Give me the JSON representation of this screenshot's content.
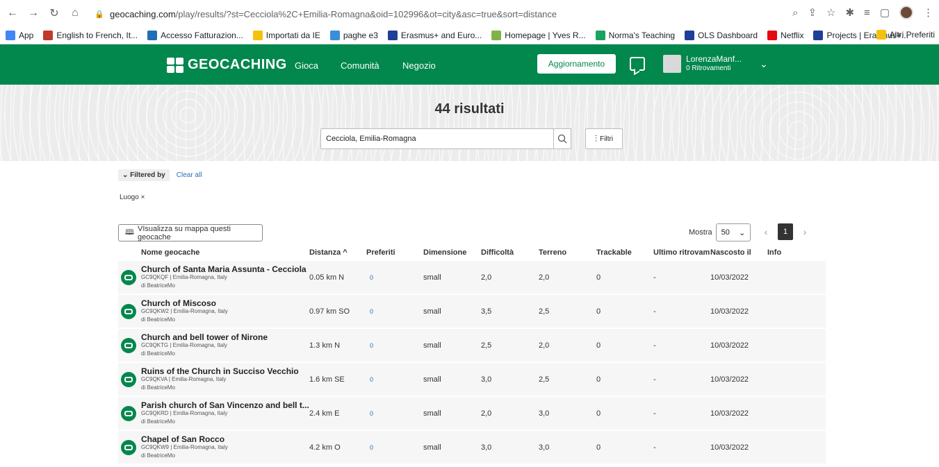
{
  "browser": {
    "url_domain": "geocaching.com",
    "url_path": "/play/results/?st=Cecciola%2C+Emilia-Romagna&oid=102996&ot=city&asc=true&sort=distance",
    "bookmarks": [
      {
        "label": "App",
        "color": "#4285f4"
      },
      {
        "label": "English to French, It...",
        "color": "#c0392b"
      },
      {
        "label": "Accesso Fatturazion...",
        "color": "#1e6fb8"
      },
      {
        "label": "Importati da IE",
        "color": "#f4c20d"
      },
      {
        "label": "paghe e3",
        "color": "#3b8ed8"
      },
      {
        "label": "Erasmus+ and Euro...",
        "color": "#1f3f99"
      },
      {
        "label": "Homepage | Yves R...",
        "color": "#7fb34a"
      },
      {
        "label": "Norma's Teaching",
        "color": "#1aa260"
      },
      {
        "label": "OLS Dashboard",
        "color": "#1f3f99"
      },
      {
        "label": "Netflix",
        "color": "#e50914"
      },
      {
        "label": "Projects | Erasmus+...",
        "color": "#1f3f99"
      }
    ],
    "other_bookmarks": "Altri Preferiti"
  },
  "header": {
    "logo": "GEOCACHING",
    "nav": [
      "Gioca",
      "Comunità",
      "Negozio"
    ],
    "upgrade": "Aggiornamento",
    "user_name": "LorenzaManf...",
    "user_finds": "0 Ritrovamenti"
  },
  "hero": {
    "title": "44 risultati",
    "search_value": "Cecciola, Emilia-Romagna",
    "filter_label": "Filtri"
  },
  "filters": {
    "filtered_by": "Filtered by",
    "clear_all": "Clear all",
    "chip": "Luogo ×"
  },
  "toolbar": {
    "map_button": "VIsualizza su mappa questi geocache",
    "show_label": "Mostra",
    "show_value": "50",
    "page": "1"
  },
  "table": {
    "headers": [
      "Nome geocache",
      "Distanza ^",
      "Preferiti",
      "Dimensione",
      "Difficoltà",
      "Terreno",
      "Trackable",
      "Ultimo ritrovam",
      "Nascosto il",
      "Info"
    ],
    "rows": [
      {
        "name": "Church of Santa Maria Assunta - Cecciola",
        "meta": "GC9QKQF | Emilia-Romagna, Italy",
        "by": "di BeatriceMo",
        "distance": "0.05 km N",
        "favorites": "0",
        "size": "small",
        "difficulty": "2,0",
        "terrain": "2,0",
        "trackable": "0",
        "last_found": "-",
        "hidden": "10/03/2022"
      },
      {
        "name": "Church of Miscoso",
        "meta": "GC9QKW2 | Emilia-Romagna, Italy",
        "by": "di BeatriceMo",
        "distance": "0.97 km SO",
        "favorites": "0",
        "size": "small",
        "difficulty": "3,5",
        "terrain": "2,5",
        "trackable": "0",
        "last_found": "-",
        "hidden": "10/03/2022"
      },
      {
        "name": "Church and bell tower of Nirone",
        "meta": "GC9QKTG | Emilia-Romagna, Italy",
        "by": "di BeatriceMo",
        "distance": "1.3 km N",
        "favorites": "0",
        "size": "small",
        "difficulty": "2,5",
        "terrain": "2,0",
        "trackable": "0",
        "last_found": "-",
        "hidden": "10/03/2022"
      },
      {
        "name": "Ruins of the Church in Succiso Vecchio",
        "meta": "GC9QKVA | Emilia-Romagna, Italy",
        "by": "di BeatriceMo",
        "distance": "1.6 km SE",
        "favorites": "0",
        "size": "small",
        "difficulty": "3,0",
        "terrain": "2,5",
        "trackable": "0",
        "last_found": "-",
        "hidden": "10/03/2022"
      },
      {
        "name": "Parish church of San Vincenzo and bell t...",
        "meta": "GC9QKRD | Emilia-Romagna, Italy",
        "by": "di BeatriceMo",
        "distance": "2.4 km E",
        "favorites": "0",
        "size": "small",
        "difficulty": "2,0",
        "terrain": "3,0",
        "trackable": "0",
        "last_found": "-",
        "hidden": "10/03/2022"
      },
      {
        "name": "Chapel of San Rocco",
        "meta": "GC9QKW9 | Emilia-Romagna, Italy",
        "by": "di BeatriceMo",
        "distance": "4.2 km O",
        "favorites": "0",
        "size": "small",
        "difficulty": "3,0",
        "terrain": "3,0",
        "trackable": "0",
        "last_found": "-",
        "hidden": "10/03/2022"
      }
    ]
  },
  "colors": {
    "brand": "#02874d",
    "link": "#2a6cb5"
  }
}
